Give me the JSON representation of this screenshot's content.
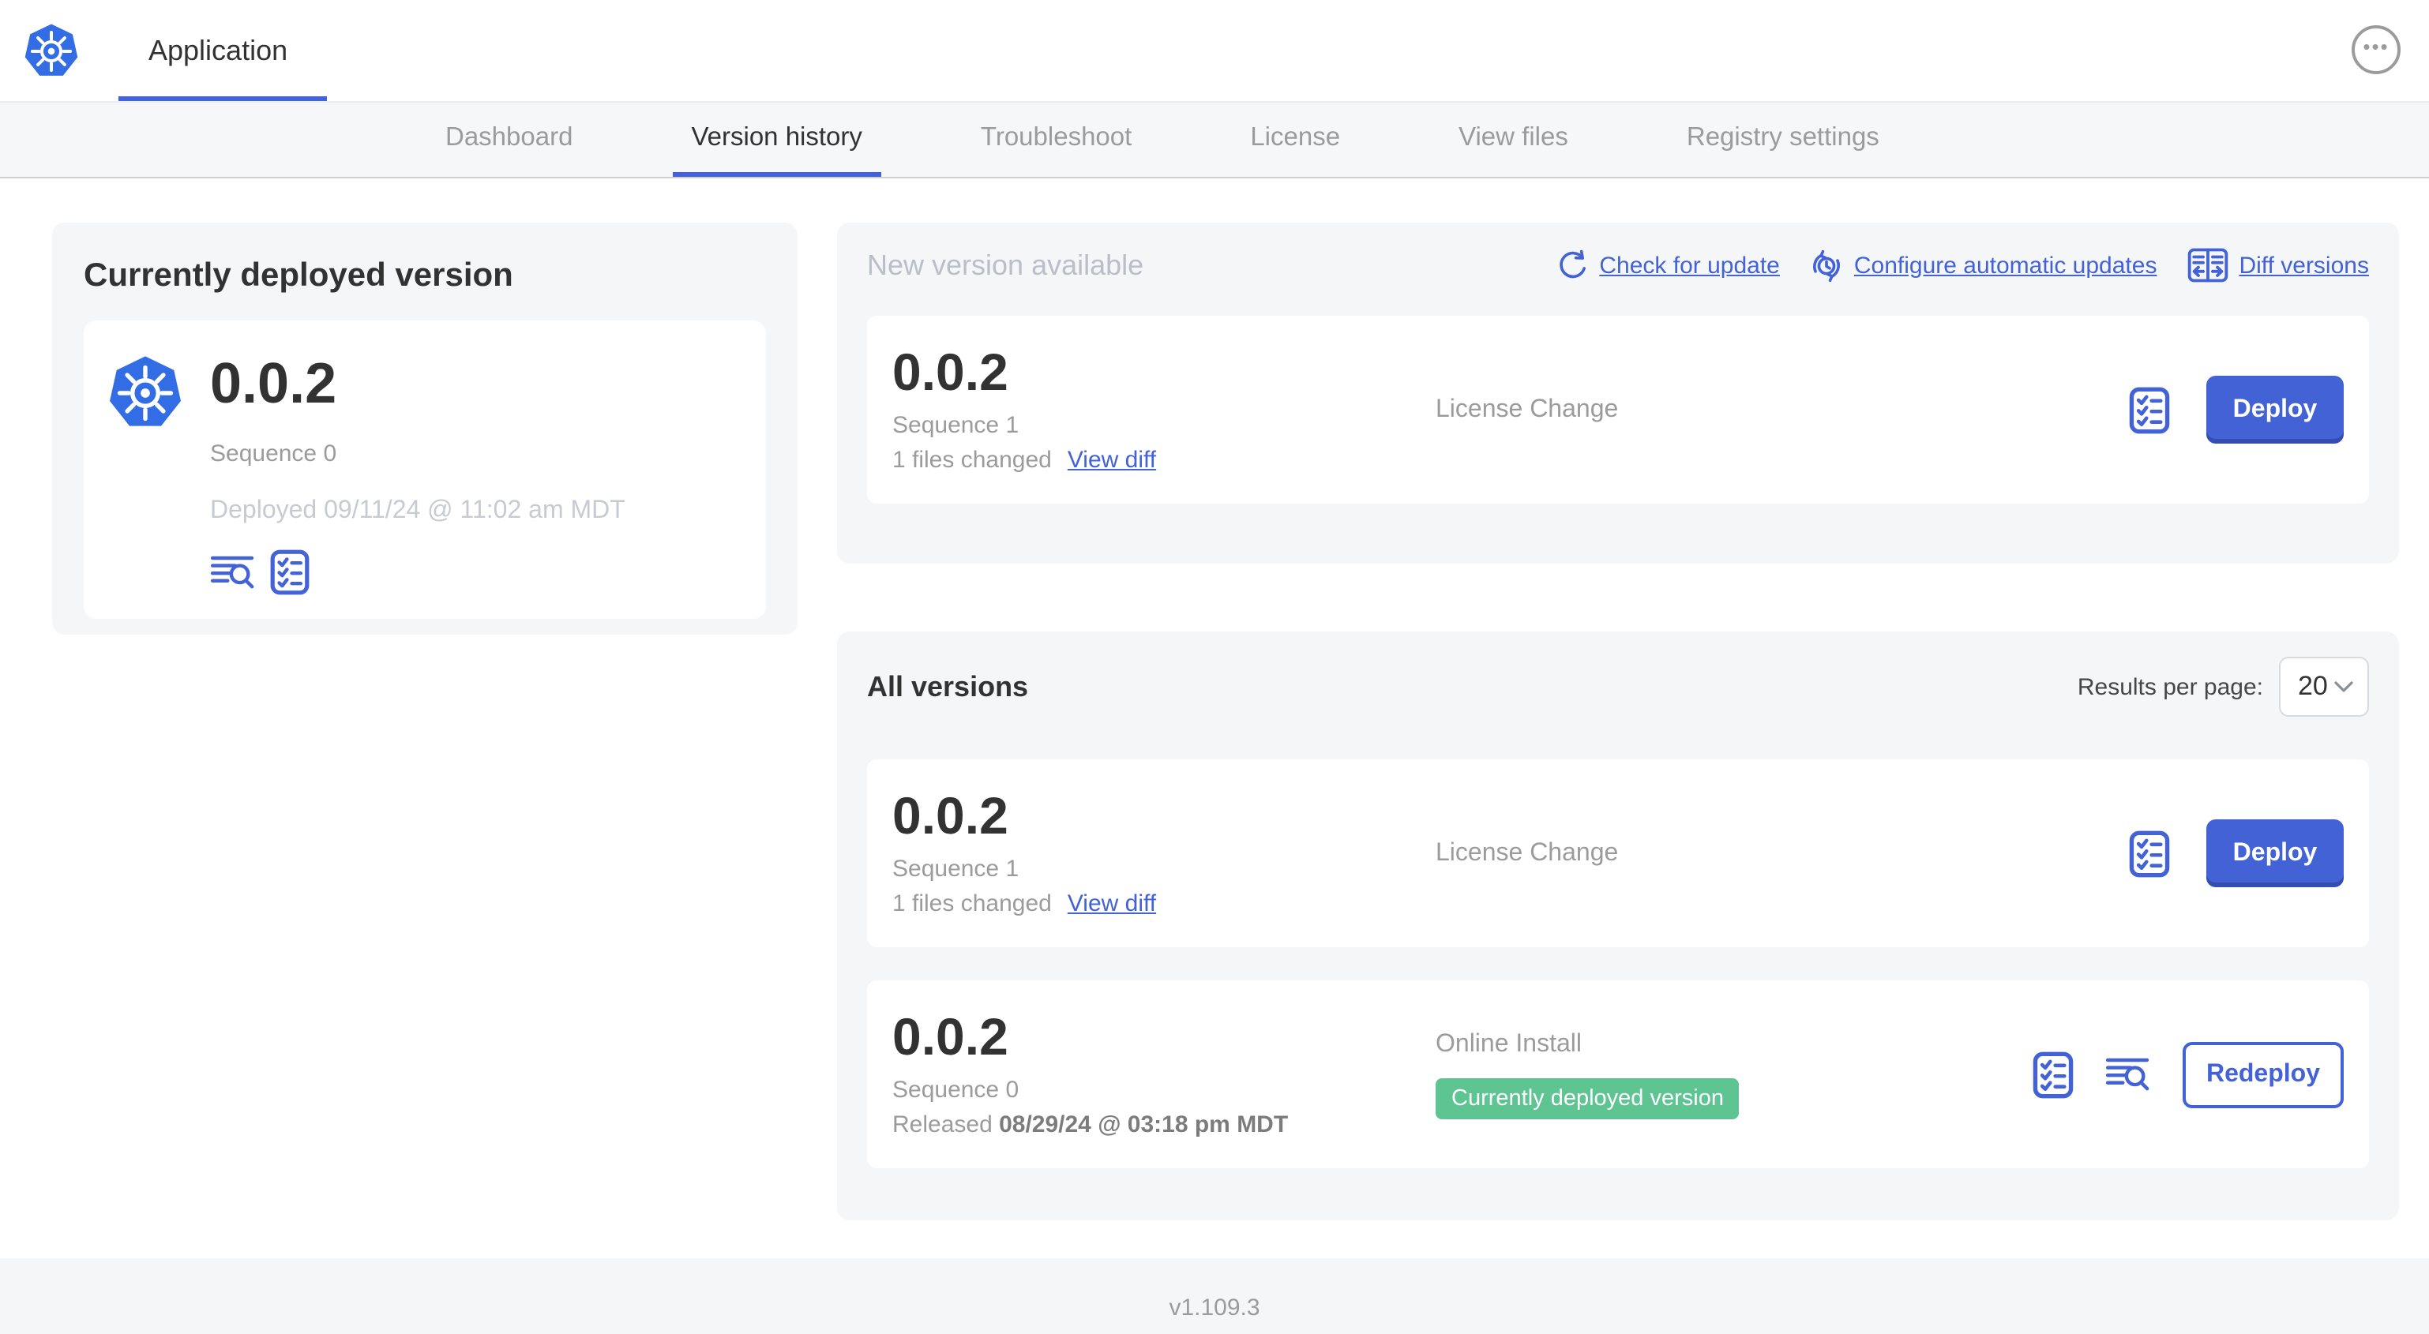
{
  "header": {
    "app_title": "Application",
    "menu_icon": "ellipsis-icon"
  },
  "nav": {
    "tabs": [
      {
        "label": "Dashboard",
        "active": false
      },
      {
        "label": "Version history",
        "active": true
      },
      {
        "label": "Troubleshoot",
        "active": false
      },
      {
        "label": "License",
        "active": false
      },
      {
        "label": "View files",
        "active": false
      },
      {
        "label": "Registry settings",
        "active": false
      }
    ]
  },
  "deployed_card": {
    "title": "Currently deployed version",
    "version": "0.0.2",
    "sequence": "Sequence 0",
    "deployed_at": "Deployed 09/11/24 @ 11:02 am MDT",
    "icons": [
      "logs-icon",
      "preflight-checklist-icon"
    ]
  },
  "new_version": {
    "title": "New version available",
    "actions": {
      "check": {
        "label": "Check for update",
        "icon": "refresh-icon"
      },
      "auto": {
        "label": "Configure automatic updates",
        "icon": "clock-sync-icon"
      },
      "diff": {
        "label": "Diff versions",
        "icon": "diff-icon"
      }
    },
    "row": {
      "version": "0.0.2",
      "sequence": "Sequence 1",
      "files_changed": "1 files changed",
      "view_diff": "View diff",
      "source": "License Change",
      "deploy": "Deploy"
    }
  },
  "all_versions": {
    "title": "All versions",
    "results_label": "Results per page:",
    "results_value": "20",
    "rows": [
      {
        "version": "0.0.2",
        "sequence": "Sequence 1",
        "files_changed": "1 files changed",
        "view_diff": "View diff",
        "source": "License Change",
        "action": "Deploy"
      },
      {
        "version": "0.0.2",
        "sequence": "Sequence 0",
        "released_prefix": "Released ",
        "released_date": "08/29/24 @ 03:18 pm MDT",
        "source": "Online Install",
        "badge": "Currently deployed version",
        "action": "Redeploy"
      }
    ]
  },
  "footer": {
    "version": "v1.109.3"
  },
  "colors": {
    "accent": "#4262d6",
    "k8s_blue": "#326de6",
    "badge_green": "#5ec492",
    "card_bg": "#f5f6f8"
  }
}
